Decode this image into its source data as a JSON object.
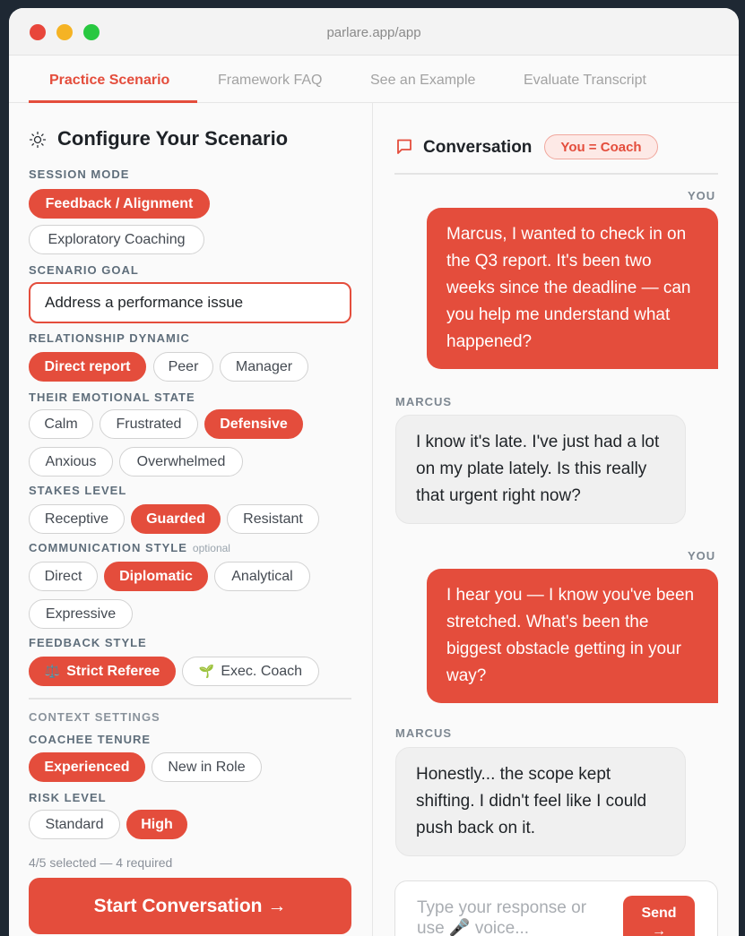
{
  "window": {
    "url": "parlare.app/app",
    "traffic_lights": {
      "close": "#e8463b",
      "minimize": "#f5b324",
      "maximize": "#28c840"
    }
  },
  "tabs": [
    {
      "label": "Practice Scenario",
      "active": true
    },
    {
      "label": "Framework FAQ",
      "active": false
    },
    {
      "label": "See an Example",
      "active": false
    },
    {
      "label": "Evaluate Transcript",
      "active": false
    }
  ],
  "config": {
    "title": "Configure Your Scenario",
    "title_icon": "sun-icon",
    "session_mode": {
      "label": "SESSION MODE",
      "options": [
        {
          "label": "Feedback / Alignment",
          "selected": true
        },
        {
          "label": "Exploratory Coaching",
          "selected": false
        }
      ]
    },
    "scenario_goal": {
      "label": "SCENARIO GOAL",
      "value": "Address a performance issue"
    },
    "relationship": {
      "label": "RELATIONSHIP DYNAMIC",
      "options": [
        {
          "label": "Direct report",
          "selected": true
        },
        {
          "label": "Peer",
          "selected": false
        },
        {
          "label": "Manager",
          "selected": false
        }
      ]
    },
    "emotional_state": {
      "label": "THEIR EMOTIONAL STATE",
      "options": [
        {
          "label": "Calm",
          "selected": false
        },
        {
          "label": "Frustrated",
          "selected": false
        },
        {
          "label": "Defensive",
          "selected": true
        },
        {
          "label": "Anxious",
          "selected": false
        },
        {
          "label": "Overwhelmed",
          "selected": false
        }
      ]
    },
    "stakes": {
      "label": "STAKES LEVEL",
      "options": [
        {
          "label": "Receptive",
          "selected": false
        },
        {
          "label": "Guarded",
          "selected": true
        },
        {
          "label": "Resistant",
          "selected": false
        }
      ]
    },
    "communication": {
      "label": "COMMUNICATION STYLE",
      "optional": "optional",
      "options": [
        {
          "label": "Direct",
          "selected": false
        },
        {
          "label": "Diplomatic",
          "selected": true
        },
        {
          "label": "Analytical",
          "selected": false
        },
        {
          "label": "Expressive",
          "selected": false
        }
      ]
    },
    "feedback_style": {
      "label": "FEEDBACK STYLE",
      "options": [
        {
          "label": "Strict Referee",
          "icon": "⚖️",
          "icon_name": "scales-icon",
          "selected": true
        },
        {
          "label": "Exec. Coach",
          "icon": "🌱",
          "icon_name": "seedling-icon",
          "selected": false
        }
      ]
    },
    "context": {
      "label": "CONTEXT SETTINGS",
      "tenure": {
        "label": "COACHEE TENURE",
        "options": [
          {
            "label": "Experienced",
            "selected": true
          },
          {
            "label": "New in Role",
            "selected": false
          }
        ]
      },
      "risk": {
        "label": "RISK LEVEL",
        "options": [
          {
            "label": "Standard",
            "selected": false
          },
          {
            "label": "High",
            "selected": true
          }
        ]
      }
    },
    "selection_status": "4/5 selected — 4 required",
    "start_button": "Start Conversation →"
  },
  "conversation": {
    "title": "Conversation",
    "title_icon": "chat-bubble-icon",
    "role_badge": "You = Coach",
    "messages": [
      {
        "speaker": "YOU",
        "text": "Marcus, I wanted to check in on the Q3 report. It's been two weeks since the deadline — can you help me understand what happened?"
      },
      {
        "speaker": "MARCUS",
        "text": "I know it's late. I've just had a lot on my plate lately. Is this really that urgent right now?"
      },
      {
        "speaker": "YOU",
        "text": "I hear you — I know you've been stretched. What's been the biggest obstacle getting in your way?"
      },
      {
        "speaker": "MARCUS",
        "text": "Honestly... the scope kept shifting. I didn't feel like I could push back on it."
      }
    ],
    "composer": {
      "placeholder": "Type your response or use 🎤 voice...",
      "send_label": "Send",
      "send_arrow": "→"
    }
  },
  "colors": {
    "accent": "#e44d3c",
    "background": "#1e2833"
  }
}
